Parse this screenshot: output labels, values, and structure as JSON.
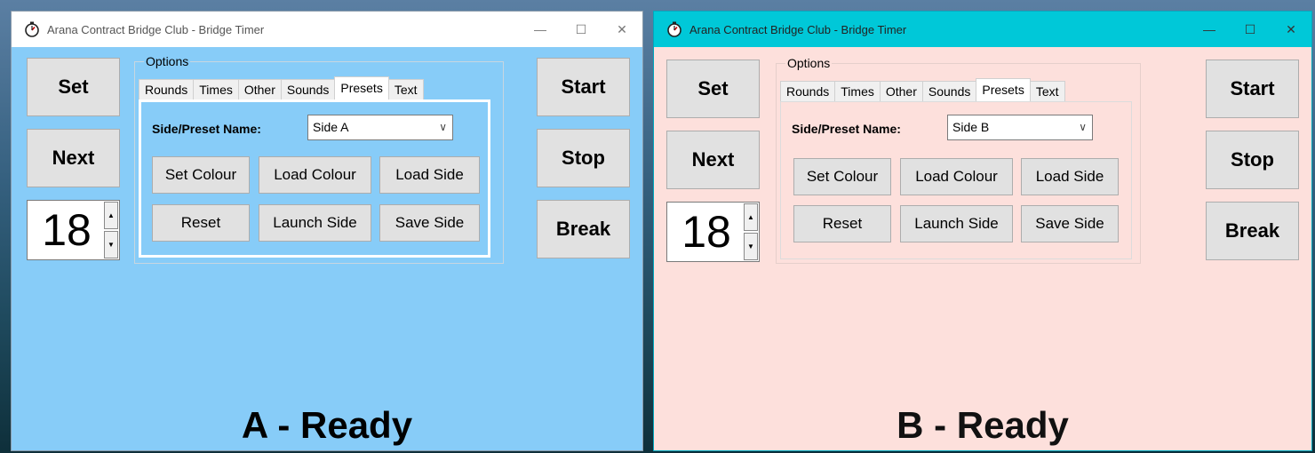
{
  "windows": [
    {
      "title": "Arana Contract Bridge Club - Bridge Timer",
      "background_color": "#87ccf8",
      "titlebar_color": "#ffffff",
      "controls": {
        "minimize": "—",
        "maximize": "☐",
        "close": "✕"
      },
      "left_buttons": {
        "set": "Set",
        "next": "Next"
      },
      "spinner": {
        "value": "18",
        "up": "▲",
        "down": "▼"
      },
      "options_label": "Options",
      "tabs": [
        "Rounds",
        "Times",
        "Other",
        "Sounds",
        "Presets",
        "Text"
      ],
      "active_tab": "Presets",
      "preset_label": "Side/Preset Name:",
      "preset_value": "Side A",
      "preset_arrow": "∨",
      "panel_buttons": {
        "set_colour": "Set Colour",
        "load_colour": "Load Colour",
        "load_side": "Load Side",
        "reset": "Reset",
        "launch_side": "Launch Side",
        "save_side": "Save Side"
      },
      "right_buttons": {
        "start": "Start",
        "stop": "Stop",
        "break": "Break"
      },
      "status": "A - Ready"
    },
    {
      "title": "Arana Contract Bridge Club - Bridge Timer",
      "background_color": "#fde0dc",
      "titlebar_color": "#00c8d8",
      "controls": {
        "minimize": "—",
        "maximize": "☐",
        "close": "✕"
      },
      "left_buttons": {
        "set": "Set",
        "next": "Next"
      },
      "spinner": {
        "value": "18",
        "up": "▲",
        "down": "▼"
      },
      "options_label": "Options",
      "tabs": [
        "Rounds",
        "Times",
        "Other",
        "Sounds",
        "Presets",
        "Text"
      ],
      "active_tab": "Presets",
      "preset_label": "Side/Preset Name:",
      "preset_value": "Side B",
      "preset_arrow": "∨",
      "panel_buttons": {
        "set_colour": "Set Colour",
        "load_colour": "Load Colour",
        "load_side": "Load Side",
        "reset": "Reset",
        "launch_side": "Launch Side",
        "save_side": "Save Side"
      },
      "right_buttons": {
        "start": "Start",
        "stop": "Stop",
        "break": "Break"
      },
      "status": "B - Ready"
    }
  ]
}
